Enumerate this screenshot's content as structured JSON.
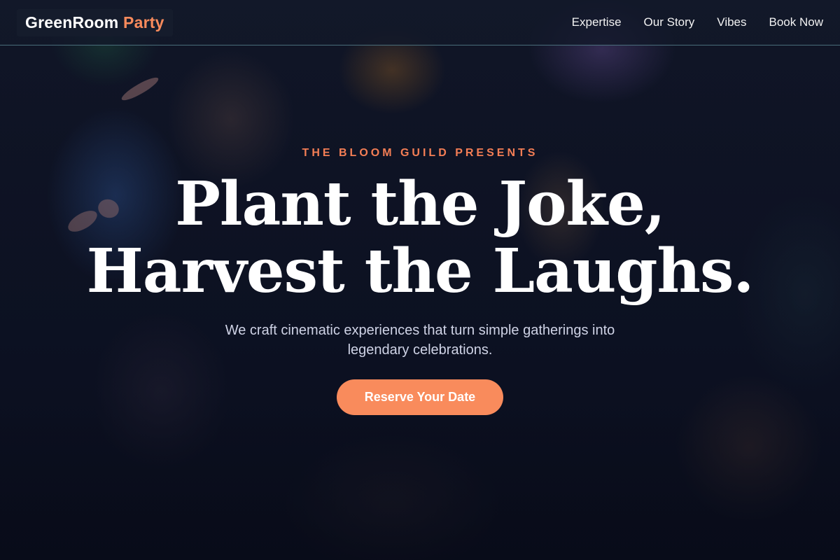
{
  "brand": {
    "name_main": "GreenRoom",
    "name_accent": "Party"
  },
  "nav": {
    "items": [
      {
        "label": "Expertise"
      },
      {
        "label": "Our Story"
      },
      {
        "label": "Vibes"
      },
      {
        "label": "Book Now"
      }
    ]
  },
  "hero": {
    "eyebrow": "THE BLOOM GUILD PRESENTS",
    "headline_line1": "Plant the Joke,",
    "headline_line2": "Harvest the Laughs.",
    "subtitle": "We craft cinematic experiences that turn simple gatherings into legendary celebrations.",
    "cta_label": "Reserve Your Date"
  },
  "colors": {
    "accent": "#f98b5c",
    "nav_background": "#12182a",
    "hero_background": "#0b1020"
  }
}
